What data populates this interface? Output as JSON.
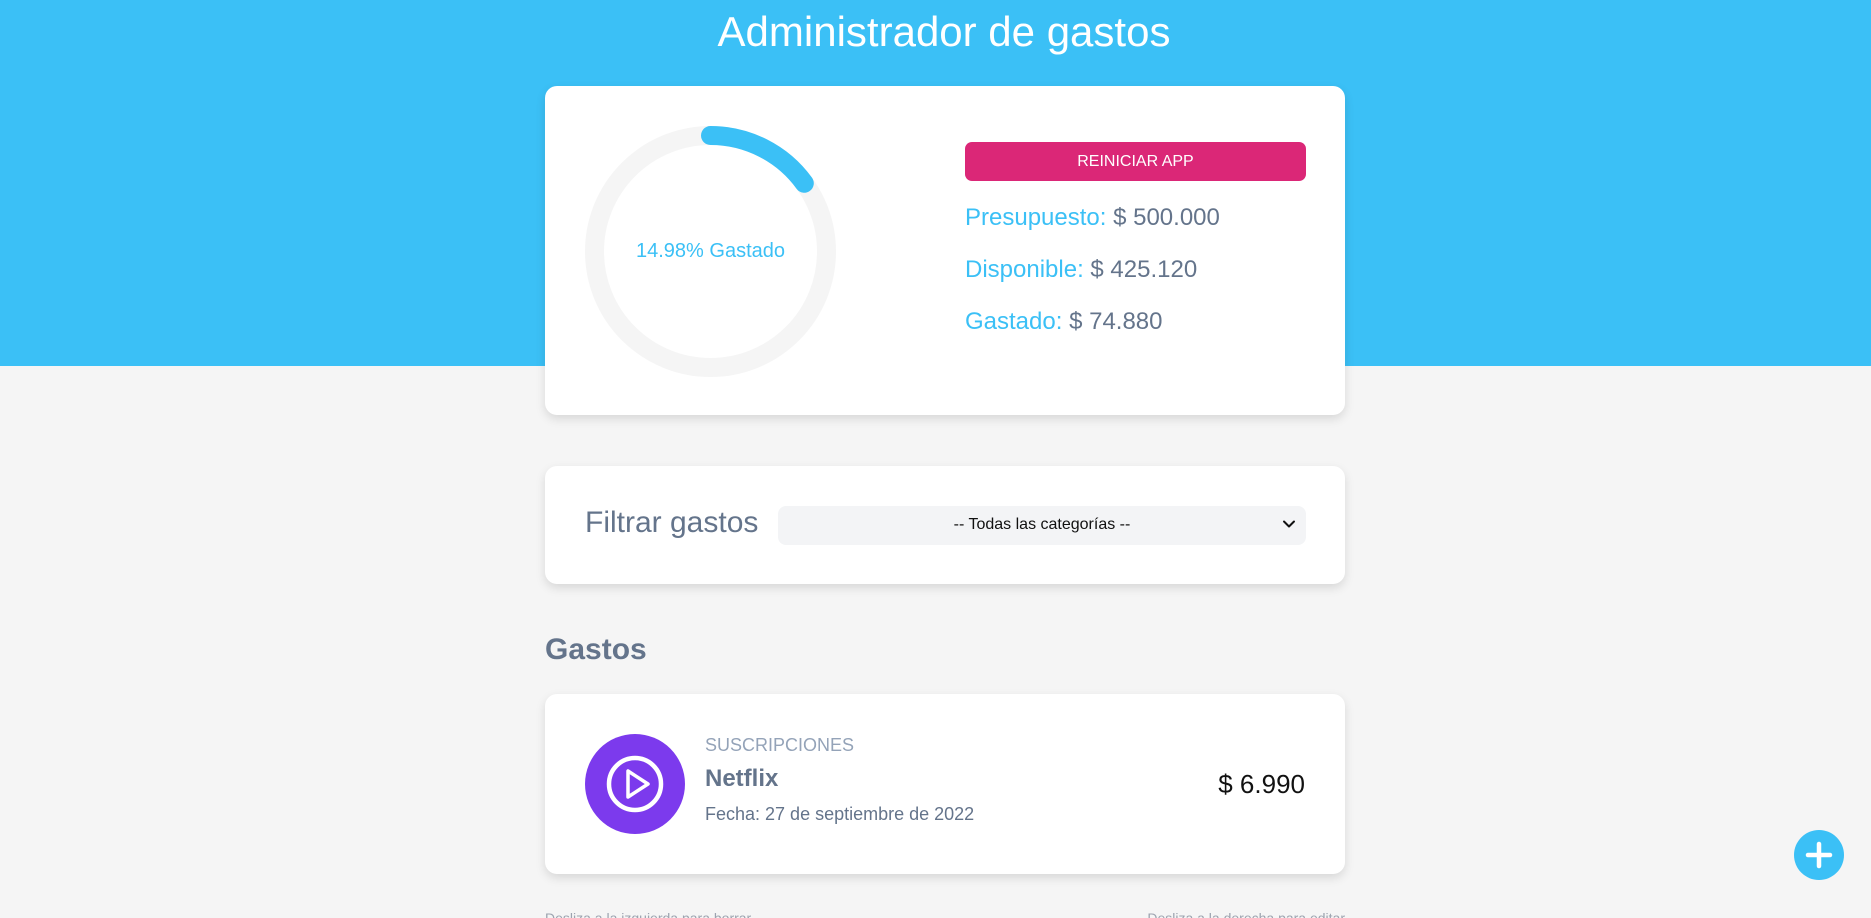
{
  "header": {
    "title": "Administrador de gastos"
  },
  "budget": {
    "percent_spent": 14.98,
    "percent_label": "14.98% Gastado",
    "reset_label": "Reiniciar App",
    "presupuesto_label": "Presupuesto:",
    "presupuesto_value": "$ 500.000",
    "disponible_label": "Disponible:",
    "disponible_value": "$ 425.120",
    "gastado_label": "Gastado:",
    "gastado_value": "$ 74.880"
  },
  "filter": {
    "label": "Filtrar gastos",
    "selected": "-- Todas las categorías --"
  },
  "expenses": {
    "title": "Gastos",
    "items": [
      {
        "category": "Suscripciones",
        "name": "Netflix",
        "date": "Fecha: 27 de septiembre de 2022",
        "amount": "$ 6.990",
        "icon": "play-icon"
      }
    ],
    "hint_left": "Desliza a la izquierda para borrar",
    "hint_right": "Desliza a la derecha para editar"
  },
  "colors": {
    "primary": "#3bc0f6",
    "reset": "#db2777",
    "category_suscripciones": "#7c3aed",
    "track": "#f5f5f5"
  }
}
